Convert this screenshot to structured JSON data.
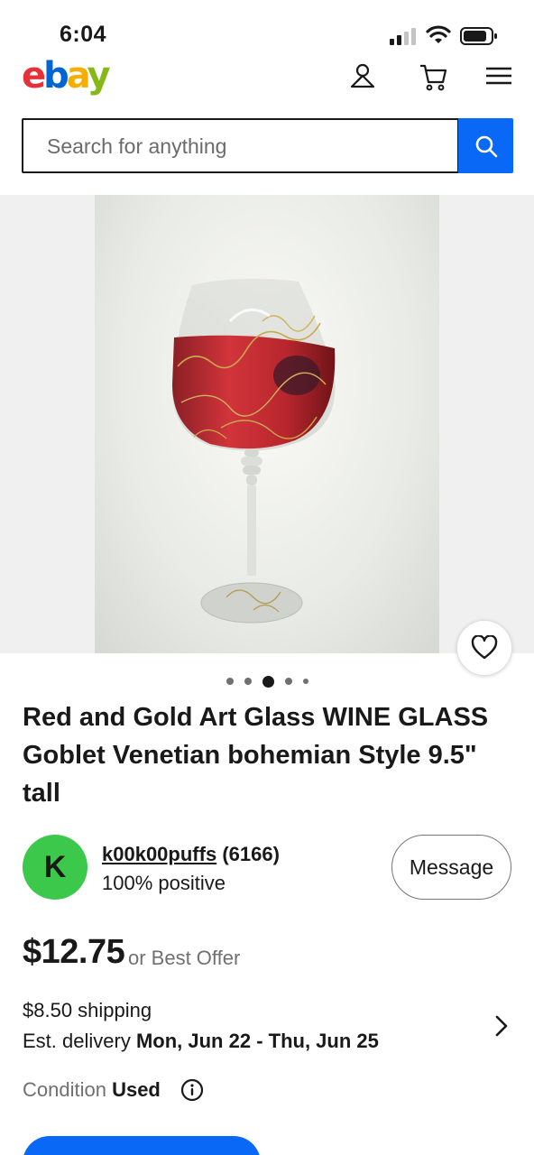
{
  "status_bar": {
    "time": "6:04",
    "icons": [
      "signal-icon",
      "wifi-icon",
      "battery-icon"
    ]
  },
  "header": {
    "logo": {
      "e": "e",
      "b": "b",
      "a": "a",
      "y": "y"
    },
    "icons": [
      "account-icon",
      "cart-icon",
      "menu-icon"
    ]
  },
  "search": {
    "placeholder": "Search for anything",
    "button_icon": "search-icon"
  },
  "gallery": {
    "image_count": 5,
    "active_index": 2,
    "favorite_icon": "heart-icon"
  },
  "listing": {
    "title": "Red and Gold Art Glass WINE GLASS Goblet Venetian bohemian Style 9.5\" tall"
  },
  "seller": {
    "avatar_letter": "K",
    "name": "k00k00puffs",
    "rating_count": "(6166)",
    "feedback": "100% positive",
    "message_label": "Message"
  },
  "pricing": {
    "price": "$12.75",
    "offer_text": "or Best Offer"
  },
  "shipping": {
    "cost": "$8.50 shipping",
    "delivery_label": "Est. delivery",
    "delivery_range": "Mon, Jun 22 - Thu, Jun 25"
  },
  "condition": {
    "label": "Condition",
    "value": "Used",
    "info_icon": "info-icon"
  },
  "colors": {
    "primary_blue": "#0968f6",
    "avatar_green": "#3cc84a",
    "text": "#191919",
    "muted": "#707070"
  }
}
